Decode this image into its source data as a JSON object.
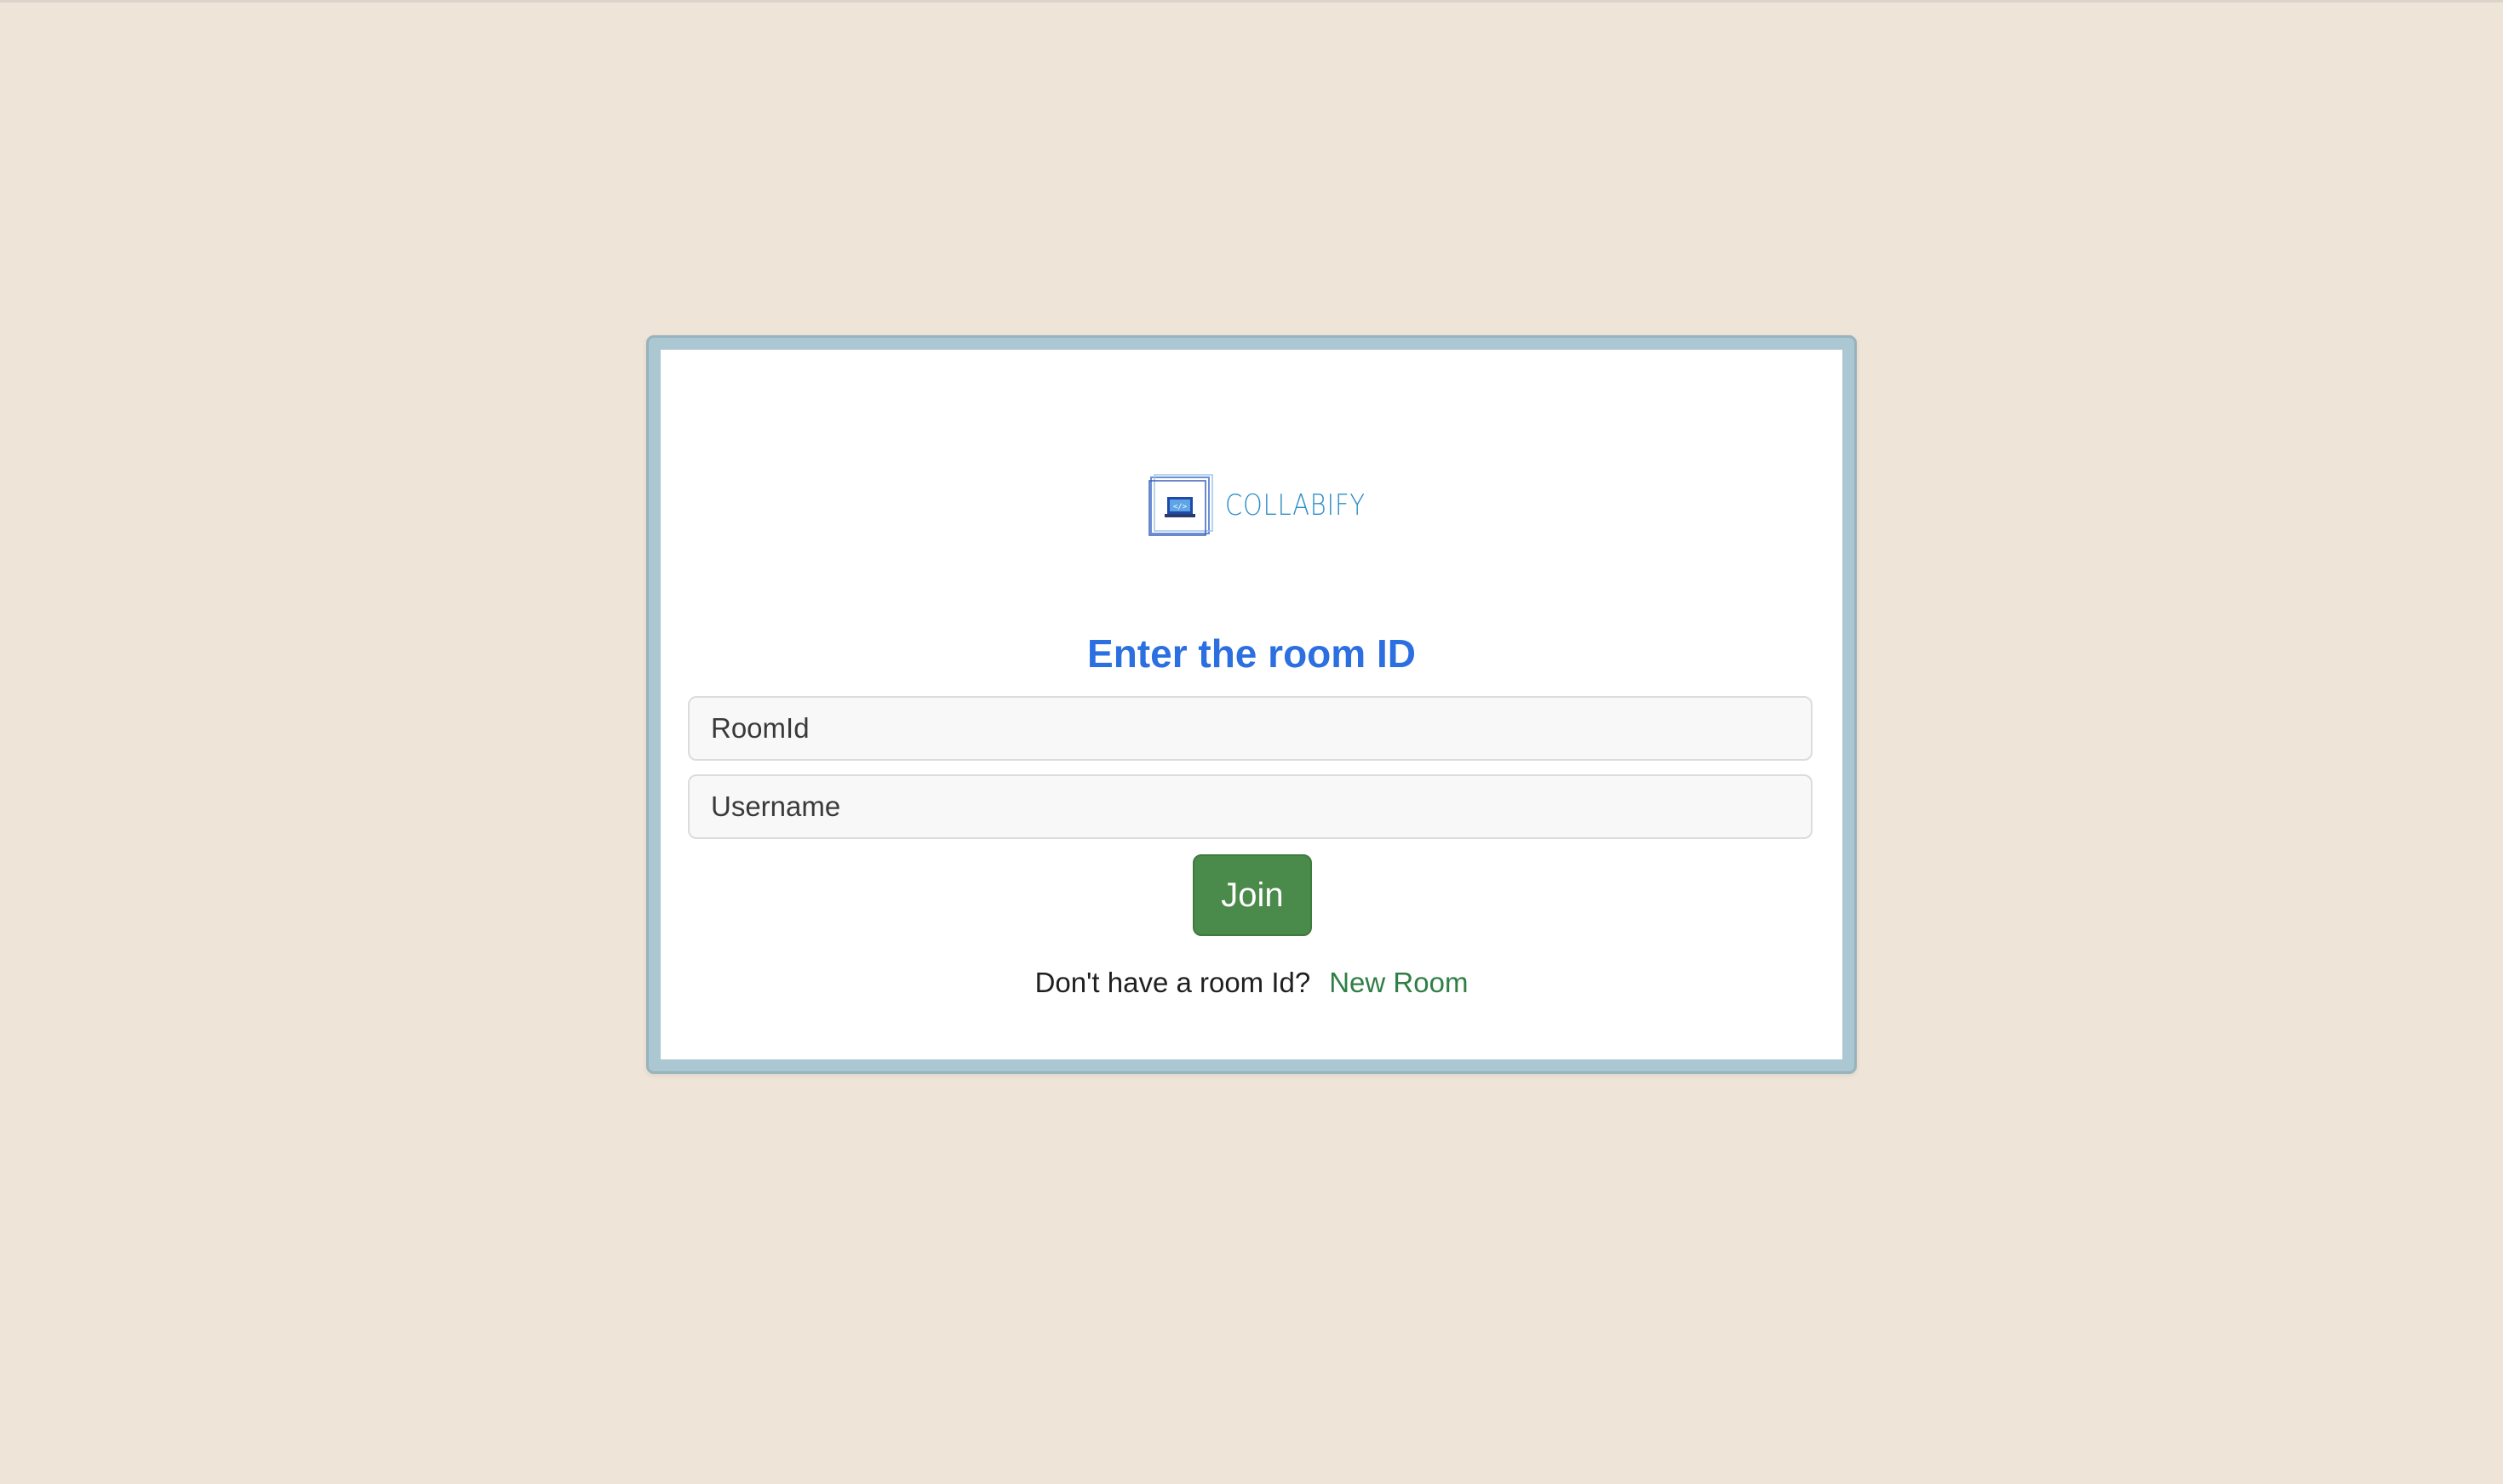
{
  "app": {
    "logo_text": "COLLABIFY",
    "logo_icon": "laptop-code-icon"
  },
  "form": {
    "title": "Enter the room ID",
    "room_id_placeholder": "RoomId",
    "room_id_value": "",
    "username_placeholder": "Username",
    "username_value": "",
    "join_label": "Join"
  },
  "footer": {
    "prompt": "Don't have a room Id?",
    "new_room_label": "New Room"
  },
  "colors": {
    "background": "#efe4d8",
    "frame": "#abc7d1",
    "title": "#2b6fe0",
    "join_button": "#4a8a4a",
    "link": "#2f7f45"
  }
}
